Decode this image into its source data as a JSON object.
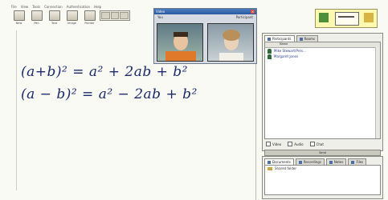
{
  "menu": [
    "File",
    "View",
    "Tools",
    "Connection",
    "Authentication",
    "Help"
  ],
  "toolbar": {
    "tools": [
      {
        "icon": "new-page-icon",
        "label": "New"
      },
      {
        "icon": "pen-icon",
        "label": "Pen"
      },
      {
        "icon": "text-icon",
        "label": "Text"
      },
      {
        "icon": "image-icon",
        "label": "Image"
      },
      {
        "icon": "pointer-icon",
        "label": "Pointer"
      }
    ]
  },
  "whiteboard": {
    "eq1": "(a+b)² = a² + 2ab + b²",
    "eq2": "(a − b)² = a² − 2ab + b²"
  },
  "video": {
    "title": "Video",
    "left_label": "You",
    "right_label": "Participant"
  },
  "panel_top": {
    "tab1": "Participants",
    "tab2": "Rooms",
    "header_col1": "",
    "header_col2": "Name",
    "users": [
      {
        "name": "Mike Stewart(Pres..."
      },
      {
        "name": "Margaret Jones"
      }
    ],
    "check1": "Video",
    "check2": "Audio",
    "check3": "Chat",
    "action": "Send"
  },
  "panel_bot": {
    "tab1": "Documents",
    "tab2": "Recordings",
    "tab3": "Notes",
    "tab4": "Files",
    "items": [
      "Shared folder"
    ]
  },
  "colors": {
    "ink": "#1a2a6a",
    "titlebar": "#2c5aa0",
    "logo_bg": "#fff8b0"
  }
}
